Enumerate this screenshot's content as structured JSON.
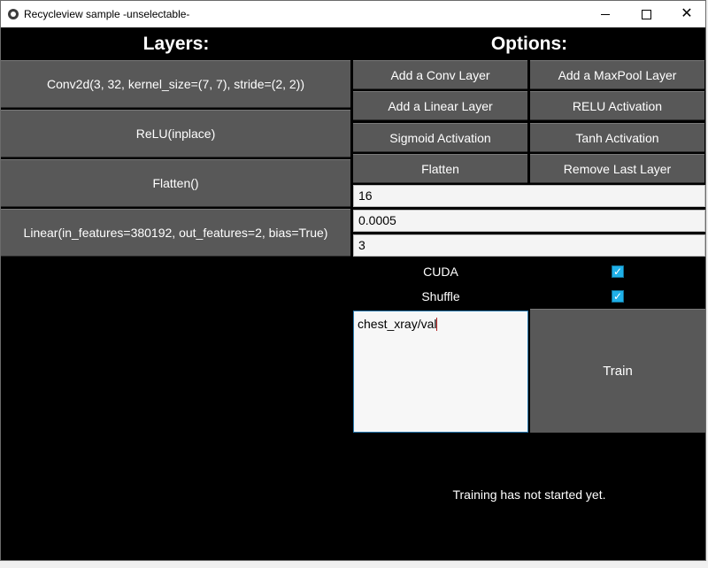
{
  "window": {
    "title": "Recycleview sample -unselectable-",
    "close_glyph": "✕"
  },
  "layers": {
    "heading": "Layers:",
    "items": [
      {
        "label": "Conv2d(3, 32, kernel_size=(7, 7), stride=(2, 2))"
      },
      {
        "label": "ReLU(inplace)"
      },
      {
        "label": "Flatten()"
      },
      {
        "label": "Linear(in_features=380192, out_features=2, bias=True)"
      }
    ]
  },
  "options": {
    "heading": "Options:",
    "buttons": {
      "add_conv": "Add a Conv Layer",
      "add_maxpool": "Add a MaxPool Layer",
      "add_linear": "Add a Linear Layer",
      "relu": "RELU Activation",
      "sigmoid": "Sigmoid Activation",
      "tanh": "Tanh Activation",
      "flatten": "Flatten",
      "remove_last": "Remove Last Layer"
    },
    "inputs": {
      "field1": "16",
      "field2": "0.0005",
      "field3": "3"
    },
    "cuda": {
      "label": "CUDA",
      "checked": true
    },
    "shuffle": {
      "label": "Shuffle",
      "checked": true
    },
    "dataset_path": "chest_xray/val",
    "train_label": "Train",
    "status": "Training has not started yet."
  },
  "colors": {
    "background": "#000000",
    "button": "#585858",
    "checkbox": "#1fb0e8"
  }
}
